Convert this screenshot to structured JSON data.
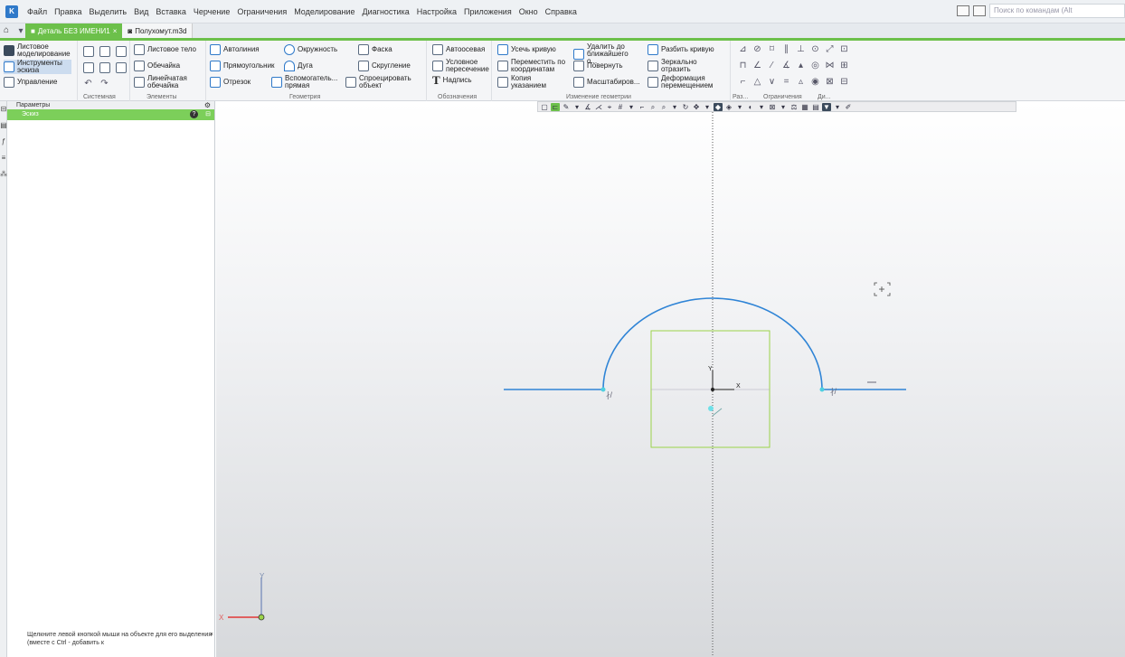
{
  "menu": {
    "logo": "K",
    "items": [
      "Файл",
      "Правка",
      "Выделить",
      "Вид",
      "Вставка",
      "Черчение",
      "Ограничения",
      "Моделирование",
      "Диагностика",
      "Настройка",
      "Приложения",
      "Окно",
      "Справка"
    ],
    "search_placeholder": "Поиск по командам (Alt"
  },
  "tabs": {
    "active": "Деталь БЕЗ ИМЕНИ1",
    "inactive": "Полухомут.m3d"
  },
  "ribbon": {
    "left": {
      "sheet_modeling": "Листовое моделирование",
      "sketch_tools": "Инструменты эскиза",
      "manage": "Управление"
    },
    "system": {
      "label": "Системная"
    },
    "elements": {
      "sheet_body": "Листовое тело",
      "shell": "Обечайка",
      "linear_shell": "Линейчатая обечайка",
      "label": "Элементы"
    },
    "geometry": {
      "autoline": "Автолиния",
      "circle": "Окружность",
      "chamfer": "Фаска",
      "rectangle": "Прямоугольник",
      "arc": "Дуга",
      "fillet": "Скругление",
      "segment": "Отрезок",
      "aux_line": "Вспомогатель... прямая",
      "project": "Спроецировать объект",
      "label": "Геометрия"
    },
    "annotations": {
      "axis": "Автоосевая",
      "conditional": "Условное пересечение",
      "text": "Надпись",
      "label": "Обозначения"
    },
    "edit": {
      "trim": "Усечь кривую",
      "delete_nearest": "Удалить до ближайшего о...",
      "split": "Разбить кривую",
      "move_coords": "Переместить по координатам",
      "rotate": "Повернуть",
      "mirror": "Зеркально отразить",
      "copy": "Копия указанием",
      "scale": "Масштабиров...",
      "deform": "Деформация перемещением",
      "label": "Изменение геометрии"
    },
    "small_labels": [
      "Раз...",
      "Ограничения",
      "Ди..."
    ]
  },
  "panel": {
    "title": "Параметры",
    "row_label": "Эскиз",
    "hint": "Щелкните левой кнопкой мыши на объекте для его выделения (вместе с Ctrl - добавить к"
  },
  "canvas": {
    "axis_x": "X",
    "axis_y": "Y",
    "origin_x": "X",
    "origin_y": "Y",
    "accent": "#2f84d6",
    "box_color": "#9bd34a"
  }
}
